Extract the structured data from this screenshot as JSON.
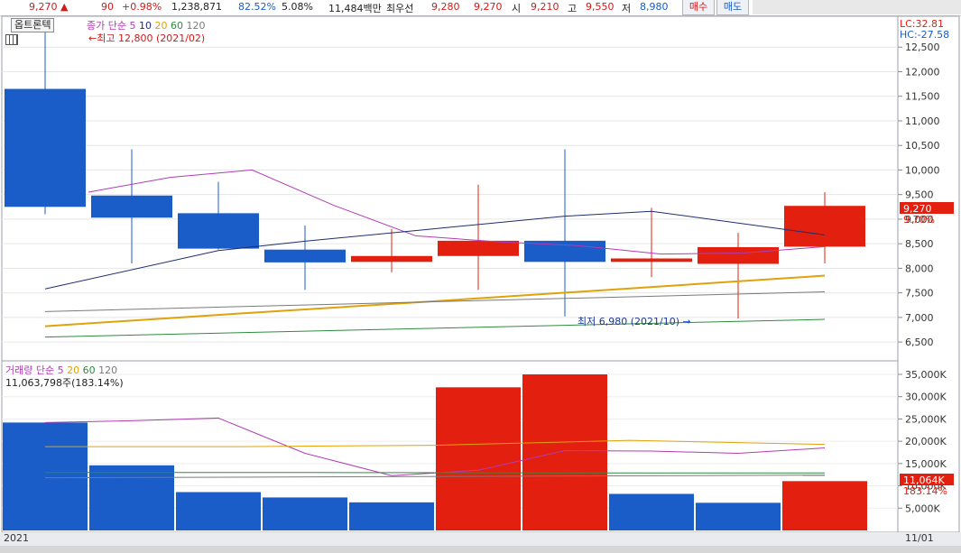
{
  "topbar": {
    "price": "9,270",
    "change": "90",
    "change_pct": "+0.98%",
    "volume": "1,238,871",
    "stat1": "82.52%",
    "stat2": "5.08%",
    "amount": "11,484백만",
    "best_label": "최우선",
    "best_ask": "9,280",
    "best_bid": "9,270",
    "open_label": "시",
    "open": "9,210",
    "high_label": "고",
    "high": "9,550",
    "low_label": "저",
    "low": "8,980",
    "buy_button": "매수",
    "sell_button": "매도"
  },
  "price_panel": {
    "tab_label": "옵트론텍",
    "legend_label": "종가 단순",
    "ma_periods": [
      "5",
      "10",
      "20",
      "60",
      "120"
    ],
    "high_note": "최고 12,800 (2021/02)",
    "low_note": "최저 6,980 (2021/10)",
    "lc": "LC:32.81",
    "hc": "HC:-27.58",
    "current_price_tag": "9,270",
    "current_pct_tag": "9.70%"
  },
  "volume_panel": {
    "legend_label": "거래량 단순",
    "ma_periods": [
      "5",
      "20",
      "60",
      "120"
    ],
    "info": "11,063,798주(183.14%)",
    "current_volume_tag": "11,064K",
    "current_pct_tag": "183.14%"
  },
  "xaxis": {
    "left_label": "2021",
    "right_label": "11/01"
  },
  "colors": {
    "up": "#e3200f",
    "down": "#1a5cc8",
    "ma5": "#b23cb5",
    "ma10": "#1e2e6e",
    "ma20": "#e0a20b",
    "ma60": "#2e8b3e",
    "ma120": "#7a7a7a"
  },
  "chart_data": [
    {
      "type": "candlestick",
      "ylim": [
        6300,
        13000
      ],
      "yticks": [
        6500,
        7000,
        7500,
        8000,
        8500,
        9000,
        9500,
        10000,
        10500,
        11000,
        11500,
        12000,
        12500
      ],
      "ytick_labels": [
        "6,500",
        "7,000",
        "7,500",
        "8,000",
        "8,500",
        "9,000",
        "9,500",
        "10,000",
        "10,500",
        "11,000",
        "11,500",
        "12,000",
        "12,500"
      ],
      "candles": [
        {
          "open": 11650,
          "close": 9250,
          "high": 12800,
          "low": 9100
        },
        {
          "open": 9480,
          "close": 9030,
          "high": 10420,
          "low": 8100
        },
        {
          "open": 9120,
          "close": 8400,
          "high": 9760,
          "low": 8380
        },
        {
          "open": 8380,
          "close": 8120,
          "high": 8870,
          "low": 7560
        },
        {
          "open": 8130,
          "close": 8250,
          "high": 8800,
          "low": 7920
        },
        {
          "open": 8250,
          "close": 8560,
          "high": 9700,
          "low": 7560
        },
        {
          "open": 8560,
          "close": 8130,
          "high": 10420,
          "low": 7020
        },
        {
          "open": 8130,
          "close": 8200,
          "high": 9230,
          "low": 7820
        },
        {
          "open": 8090,
          "close": 8430,
          "high": 8720,
          "low": 6980
        },
        {
          "open": 8440,
          "close": 9270,
          "high": 9550,
          "low": 8100
        }
      ],
      "series": [
        {
          "name": "5",
          "values": [
            null,
            9550,
            9850,
            10000,
            9280,
            8660,
            8540,
            8460,
            8290,
            8310,
            8440
          ]
        },
        {
          "name": "10",
          "values": [
            7580,
            null,
            8360,
            8550,
            null,
            null,
            9060,
            9160,
            null,
            8680
          ]
        },
        {
          "name": "20",
          "values": [
            6820,
            7080,
            7330,
            7590,
            7850
          ]
        },
        {
          "name": "60",
          "values": [
            6600,
            6960
          ]
        },
        {
          "name": "120",
          "values": [
            7120,
            7520
          ]
        }
      ]
    },
    {
      "type": "bar",
      "ylim": [
        0,
        36000
      ],
      "yticks": [
        5000,
        10000,
        15000,
        20000,
        25000,
        30000,
        35000
      ],
      "ytick_labels": [
        "5,000K",
        "10,000K",
        "15,000K",
        "20,000K",
        "25,000K",
        "30,000K",
        "35,000K"
      ],
      "values": [
        24200,
        14600,
        8600,
        7400,
        6300,
        32100,
        35000,
        8200,
        6200,
        11064
      ],
      "up": [
        false,
        false,
        false,
        false,
        false,
        true,
        true,
        false,
        false,
        true
      ],
      "series": [
        {
          "name": "5",
          "values": [
            24200,
            24600,
            25200,
            17300,
            12300,
            13500,
            17900,
            17800,
            17300,
            18500
          ]
        },
        {
          "name": "20",
          "values": [
            18800,
            18800,
            19100,
            20200,
            19300
          ]
        },
        {
          "name": "60",
          "values": [
            13000,
            13000,
            12900,
            12900
          ]
        },
        {
          "name": "120",
          "values": [
            11800,
            12400
          ]
        }
      ]
    }
  ]
}
